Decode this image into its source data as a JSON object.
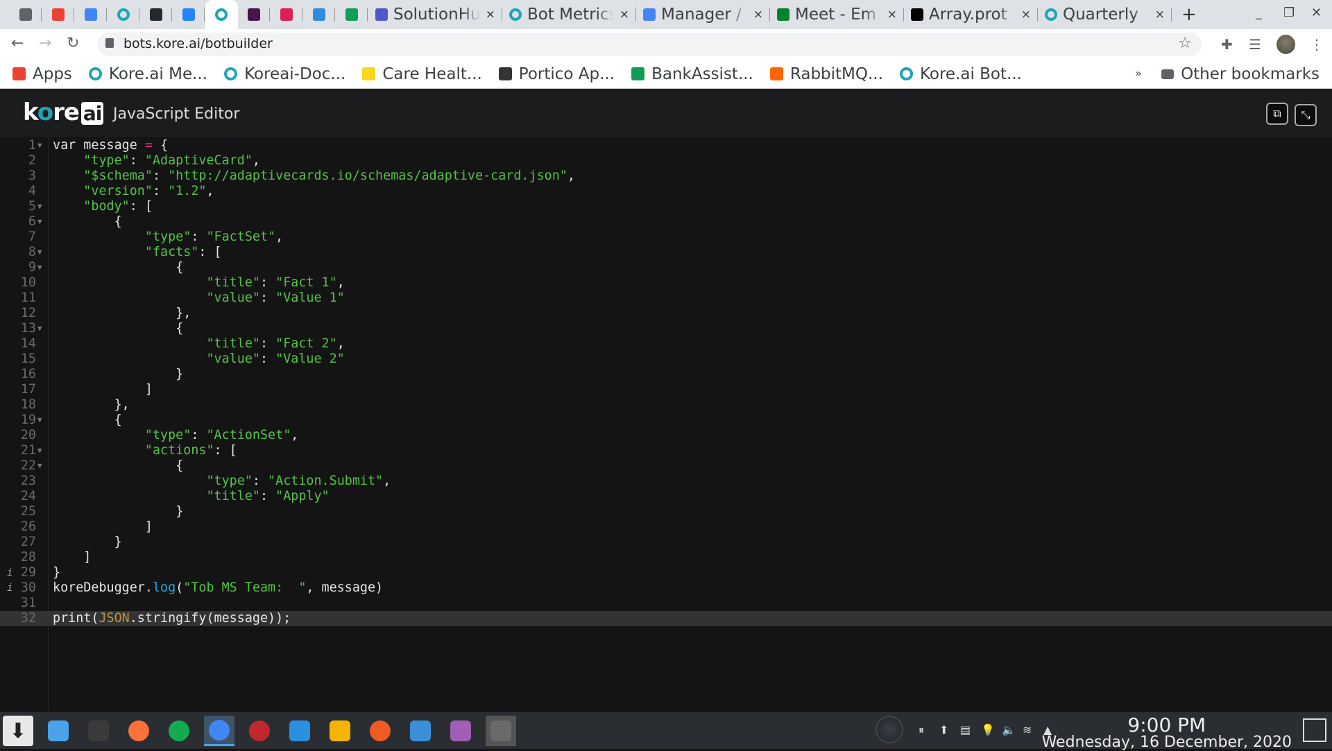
{
  "browser": {
    "pinned_tabs": [
      {
        "icon": "globe-icon",
        "color": "#5f6368"
      },
      {
        "icon": "gmail-icon",
        "color": "#ea4335"
      },
      {
        "icon": "docs-icon",
        "color": "#4285f4"
      },
      {
        "icon": "kore-icon",
        "color": "#1fa5b5"
      },
      {
        "icon": "github-icon",
        "color": "#24292e"
      },
      {
        "icon": "jira-icon",
        "color": "#2684ff"
      },
      {
        "icon": "kore-icon",
        "color": "#1fa5b5",
        "active": true
      },
      {
        "icon": "slack-workspace-icon",
        "color": "#4a154b"
      },
      {
        "icon": "slack-icon",
        "color": "#e01e5a"
      },
      {
        "icon": "outlook-icon",
        "color": "#2f8ddb"
      },
      {
        "icon": "sheets-icon",
        "color": "#0f9d58"
      }
    ],
    "tabs": [
      {
        "label": "SolutionHub",
        "icon": "teams-icon",
        "color": "#5059c9"
      },
      {
        "label": "Bot Metrics",
        "icon": "kore-icon",
        "color": "#1fa5b5"
      },
      {
        "label": "Manager / ",
        "icon": "docs-icon",
        "color": "#4285f4"
      },
      {
        "label": "Meet - Em",
        "icon": "meet-icon",
        "color": "#00832d"
      },
      {
        "label": "Array.prot",
        "icon": "mdn-icon",
        "color": "#000000"
      },
      {
        "label": "Quarterly",
        "icon": "kore-icon",
        "color": "#1fa5b5"
      }
    ],
    "tab_close": "×",
    "new_tab": "+",
    "window_controls": {
      "minimize": "_",
      "restore": "❐",
      "close": "✕"
    },
    "url": "bots.kore.ai/botbuilder",
    "bookmarks": [
      {
        "label": "Apps",
        "icon": "apps-grid-icon",
        "color": "#ea4335"
      },
      {
        "label": "Kore.ai Me...",
        "icon": "kore-icon",
        "color": "#1fa5b5"
      },
      {
        "label": "Koreai-Doc...",
        "icon": "kore-icon",
        "color": "#1fa5b5"
      },
      {
        "label": "Care Healt...",
        "icon": "care-icon",
        "color": "#f9d71c"
      },
      {
        "label": "Portico Ap...",
        "icon": "portico-icon",
        "color": "#333333"
      },
      {
        "label": "BankAssist...",
        "icon": "sheets-icon",
        "color": "#0f9d58"
      },
      {
        "label": "RabbitMQ...",
        "icon": "rabbitmq-icon",
        "color": "#ff6600"
      },
      {
        "label": "Kore.ai Bot...",
        "icon": "kore-icon",
        "color": "#1fa5b5"
      }
    ],
    "bookmarks_overflow": "»",
    "other_bookmarks": "Other bookmarks"
  },
  "app": {
    "logo": "kore.ai",
    "title": "JavaScript Editor",
    "buttons": {
      "copy": "⧉",
      "collapse": "⤡"
    }
  },
  "editor": {
    "current_line": 32,
    "fold_lines": [
      1,
      5,
      6,
      8,
      9,
      13,
      19,
      21,
      22
    ],
    "info_lines": [
      29,
      30
    ],
    "lines": [
      [
        [
          "",
          "var message "
        ],
        [
          "o",
          "="
        ],
        [
          "",
          " {"
        ]
      ],
      [
        [
          "",
          "    "
        ],
        [
          "s",
          "\"type\""
        ],
        [
          "",
          ": "
        ],
        [
          "s",
          "\"AdaptiveCard\""
        ],
        [
          "",
          ","
        ]
      ],
      [
        [
          "",
          "    "
        ],
        [
          "s",
          "\"$schema\""
        ],
        [
          "",
          ": "
        ],
        [
          "s",
          "\"http://adaptivecards.io/schemas/adaptive-card.json\""
        ],
        [
          "",
          ","
        ]
      ],
      [
        [
          "",
          "    "
        ],
        [
          "s",
          "\"version\""
        ],
        [
          "",
          ": "
        ],
        [
          "s",
          "\"1.2\""
        ],
        [
          "",
          ","
        ]
      ],
      [
        [
          "",
          "    "
        ],
        [
          "s",
          "\"body\""
        ],
        [
          "",
          ": ["
        ]
      ],
      [
        [
          "",
          "        {"
        ]
      ],
      [
        [
          "",
          "            "
        ],
        [
          "s",
          "\"type\""
        ],
        [
          "",
          ": "
        ],
        [
          "s",
          "\"FactSet\""
        ],
        [
          "",
          ","
        ]
      ],
      [
        [
          "",
          "            "
        ],
        [
          "s",
          "\"facts\""
        ],
        [
          "",
          ": ["
        ]
      ],
      [
        [
          "",
          "                {"
        ]
      ],
      [
        [
          "",
          "                    "
        ],
        [
          "s",
          "\"title\""
        ],
        [
          "",
          ": "
        ],
        [
          "s",
          "\"Fact 1\""
        ],
        [
          "",
          ","
        ]
      ],
      [
        [
          "",
          "                    "
        ],
        [
          "s",
          "\"value\""
        ],
        [
          "",
          ": "
        ],
        [
          "s",
          "\"Value 1\""
        ]
      ],
      [
        [
          "",
          "                },"
        ]
      ],
      [
        [
          "",
          "                {"
        ]
      ],
      [
        [
          "",
          "                    "
        ],
        [
          "s",
          "\"title\""
        ],
        [
          "",
          ": "
        ],
        [
          "s",
          "\"Fact 2\""
        ],
        [
          "",
          ","
        ]
      ],
      [
        [
          "",
          "                    "
        ],
        [
          "s",
          "\"value\""
        ],
        [
          "",
          ": "
        ],
        [
          "s",
          "\"Value 2\""
        ]
      ],
      [
        [
          "",
          "                }"
        ]
      ],
      [
        [
          "",
          "            ]"
        ]
      ],
      [
        [
          "",
          "        },"
        ]
      ],
      [
        [
          "",
          "        {"
        ]
      ],
      [
        [
          "",
          "            "
        ],
        [
          "s",
          "\"type\""
        ],
        [
          "",
          ": "
        ],
        [
          "s",
          "\"ActionSet\""
        ],
        [
          "",
          ","
        ]
      ],
      [
        [
          "",
          "            "
        ],
        [
          "s",
          "\"actions\""
        ],
        [
          "",
          ": ["
        ]
      ],
      [
        [
          "",
          "                {"
        ]
      ],
      [
        [
          "",
          "                    "
        ],
        [
          "s",
          "\"type\""
        ],
        [
          "",
          ": "
        ],
        [
          "s",
          "\"Action.Submit\""
        ],
        [
          "",
          ","
        ]
      ],
      [
        [
          "",
          "                    "
        ],
        [
          "s",
          "\"title\""
        ],
        [
          "",
          ": "
        ],
        [
          "s",
          "\"Apply\""
        ]
      ],
      [
        [
          "",
          "                }"
        ]
      ],
      [
        [
          "",
          "            ]"
        ]
      ],
      [
        [
          "",
          "        }"
        ]
      ],
      [
        [
          "",
          "    ]"
        ]
      ],
      [
        [
          "",
          "}"
        ]
      ],
      [
        [
          "",
          "koreDebugger."
        ],
        [
          "f",
          "log"
        ],
        [
          "",
          "("
        ],
        [
          "s",
          "\"Tob MS Team:  \""
        ],
        [
          "",
          ", message)"
        ]
      ],
      [
        [
          "",
          ""
        ]
      ],
      [
        [
          "",
          "print("
        ],
        [
          "k",
          "JSON"
        ],
        [
          "",
          ".stringify(message));"
        ]
      ]
    ]
  },
  "taskbar": {
    "apps": [
      {
        "icon": "download-icon",
        "color": "#e8e8e8"
      },
      {
        "icon": "app-grid-icon",
        "color": "#4aa3e8"
      },
      {
        "icon": "terminal-icon",
        "color": "#3a3a3a"
      },
      {
        "icon": "firefox-icon",
        "color": "#ff7139"
      },
      {
        "icon": "mongodb-compass-icon",
        "color": "#13aa52"
      },
      {
        "icon": "chrome-icon",
        "color": "#4285f4",
        "active": true
      },
      {
        "icon": "redis-desktop-icon",
        "color": "#c0282d"
      },
      {
        "icon": "vscode-icon",
        "color": "#2b8fe0"
      },
      {
        "icon": "basket-icon",
        "color": "#f4b400"
      },
      {
        "icon": "postman-icon",
        "color": "#ef5b25"
      },
      {
        "icon": "files-icon",
        "color": "#3b8fd9"
      },
      {
        "icon": "video-icon",
        "color": "#a05fb5"
      },
      {
        "icon": "nodejs-icon",
        "color": "#6a6a6a"
      }
    ],
    "tray": [
      "pause-icon",
      "update-icon",
      "clipboard-icon",
      "lightbulb-icon",
      "volume-icon",
      "wifi-icon",
      "expand-tray-icon"
    ],
    "time": "9:00 PM",
    "date": "Wednesday, 16 December, 2020"
  }
}
